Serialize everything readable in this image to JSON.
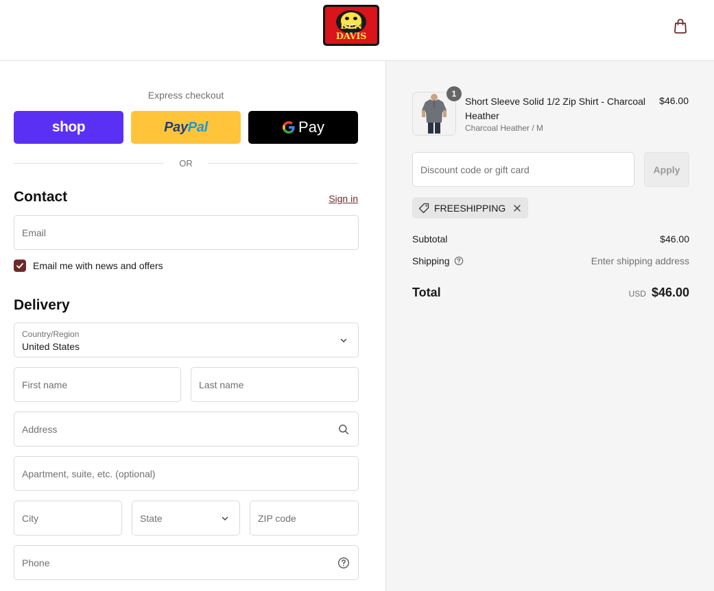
{
  "brand": {
    "logo_text": "BEN DAVIS",
    "logo_colors": {
      "background": "#d9141a",
      "text": "#ffe34a",
      "border": "#111111"
    }
  },
  "header": {
    "cart_icon": "shopping-bag-icon"
  },
  "express_checkout": {
    "label": "Express checkout",
    "shop_label": "shop",
    "paypal_label_1": "Pay",
    "paypal_label_2": "Pal",
    "gpay_label": "Pay",
    "or_label": "OR",
    "colors": {
      "shop": "#5a31f4",
      "paypal": "#ffc439",
      "gpay": "#000000"
    }
  },
  "contact": {
    "title": "Contact",
    "sign_in": "Sign in",
    "email_placeholder": "Email",
    "newsletter_label": "Email me with news and offers",
    "newsletter_checked": true
  },
  "delivery": {
    "title": "Delivery",
    "country_label": "Country/Region",
    "country_value": "United States",
    "first_name_placeholder": "First name",
    "last_name_placeholder": "Last name",
    "address_placeholder": "Address",
    "apartment_placeholder": "Apartment, suite, etc. (optional)",
    "city_placeholder": "City",
    "state_label": "State",
    "zip_placeholder": "ZIP code",
    "phone_placeholder": "Phone"
  },
  "order": {
    "item": {
      "name": "Short Sleeve Solid 1/2 Zip Shirt - Charcoal Heather",
      "variant": "Charcoal Heather / M",
      "price": "$46.00",
      "quantity": "1"
    },
    "discount_placeholder": "Discount code or gift card",
    "apply_label": "Apply",
    "applied_code": "FREESHIPPING",
    "subtotal_label": "Subtotal",
    "subtotal_value": "$46.00",
    "shipping_label": "Shipping",
    "shipping_value": "Enter shipping address",
    "total_label": "Total",
    "currency": "USD",
    "total_value": "$46.00"
  },
  "accent_color": "#6b2b2b"
}
